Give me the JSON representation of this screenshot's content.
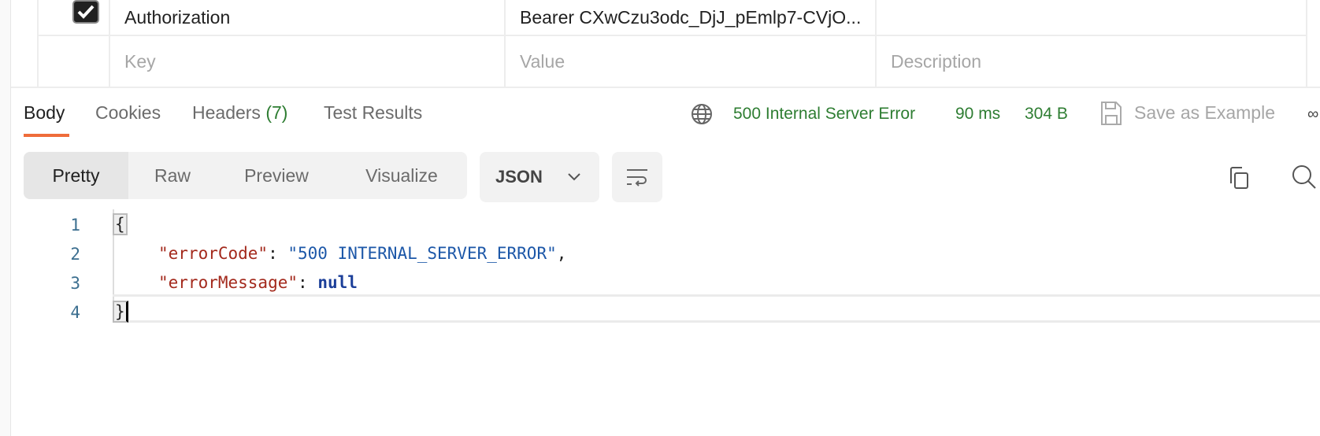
{
  "params": {
    "rows": [
      {
        "checked": true,
        "key": "Authorization",
        "value": "Bearer CXwCzu3odc_DjJ_pEmlp7-CVjO...",
        "description": ""
      }
    ],
    "placeholder": {
      "key": "Key",
      "value": "Value",
      "description": "Description"
    }
  },
  "response": {
    "tabs": [
      {
        "label": "Body",
        "active": true
      },
      {
        "label": "Cookies"
      },
      {
        "label": "Headers",
        "count": "(7)"
      },
      {
        "label": "Test Results"
      }
    ],
    "status": "500 Internal Server Error",
    "time": "90 ms",
    "size": "304 B",
    "save_label": "Save as Example",
    "status_color": "#2e7d32",
    "accent": "#ef6c3a",
    "views": [
      "Pretty",
      "Raw",
      "Preview",
      "Visualize"
    ],
    "format": "JSON",
    "code": {
      "line_numbers": [
        "1",
        "2",
        "3",
        "4"
      ],
      "open": "{",
      "close": "}",
      "key1": "\"errorCode\"",
      "val1": "\"500 INTERNAL_SERVER_ERROR\"",
      "key2": "\"errorMessage\"",
      "val2": "null",
      "colon": ": ",
      "comma": ","
    }
  }
}
